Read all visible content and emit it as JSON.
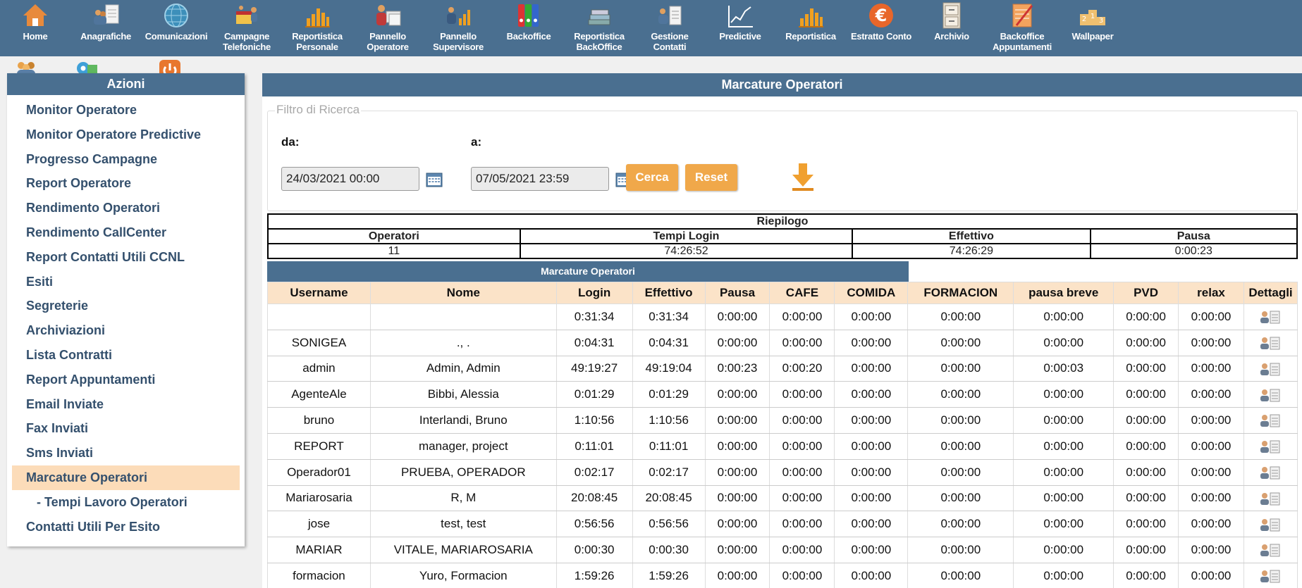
{
  "toolbar": [
    {
      "label": "Home",
      "icon": "home-icon"
    },
    {
      "label": "Anagrafiche",
      "icon": "people-document-icon"
    },
    {
      "label": "Comunicazioni",
      "icon": "globe-network-icon"
    },
    {
      "label": "Campagne\nTelefoniche",
      "icon": "campaign-people-icon"
    },
    {
      "label": "Reportistica\nPersonale",
      "icon": "bar-chart-icon"
    },
    {
      "label": "Pannello\nOperatore",
      "icon": "operator-windows-icon"
    },
    {
      "label": "Pannello\nSupervisore",
      "icon": "supervisor-chart-icon"
    },
    {
      "label": "Backoffice",
      "icon": "binders-icon"
    },
    {
      "label": "Reportistica\nBackOffice",
      "icon": "book-stack-icon"
    },
    {
      "label": "Gestione\nContatti",
      "icon": "contacts-icon"
    },
    {
      "label": "Predictive",
      "icon": "trend-chart-icon"
    },
    {
      "label": "Reportistica",
      "icon": "bar-chart-icon"
    },
    {
      "label": "Estratto Conto",
      "icon": "euro-icon"
    },
    {
      "label": "Archivio",
      "icon": "cabinet-icon"
    },
    {
      "label": "Backoffice\nAppuntamenti",
      "icon": "notepad-icon"
    },
    {
      "label": "Wallpaper",
      "icon": "podium-icon"
    }
  ],
  "sidebar": {
    "title": "Azioni",
    "items": [
      {
        "label": "Monitor Operatore",
        "state": "normal"
      },
      {
        "label": "Monitor Operatore Predictive",
        "state": "normal"
      },
      {
        "label": "Progresso Campagne",
        "state": "normal"
      },
      {
        "label": "Report Operatore",
        "state": "normal"
      },
      {
        "label": "Rendimento Operatori",
        "state": "normal"
      },
      {
        "label": "Rendimento CallCenter",
        "state": "normal"
      },
      {
        "label": "Report Contatti Utili CCNL",
        "state": "normal"
      },
      {
        "label": "Esiti",
        "state": "normal"
      },
      {
        "label": "Segreterie",
        "state": "normal"
      },
      {
        "label": "Archiviazioni",
        "state": "normal"
      },
      {
        "label": "Lista Contratti",
        "state": "normal"
      },
      {
        "label": "Report Appuntamenti",
        "state": "normal"
      },
      {
        "label": "Email Inviate",
        "state": "normal"
      },
      {
        "label": "Fax Inviati",
        "state": "normal"
      },
      {
        "label": "Sms Inviati",
        "state": "normal"
      },
      {
        "label": "Marcature Operatori",
        "state": "active"
      },
      {
        "label": "- Tempi Lavoro Operatori",
        "state": "sub"
      },
      {
        "label": "Contatti Utili Per Esito",
        "state": "normal"
      }
    ]
  },
  "main": {
    "title": "Marcature Operatori",
    "filter": {
      "legend": "Filtro di Ricerca",
      "from_label": "da:",
      "from_value": "24/03/2021 00:00",
      "to_label": "a:",
      "to_value": "07/05/2021 23:59",
      "search_label": "Cerca",
      "reset_label": "Reset"
    },
    "summary": {
      "title": "Riepilogo",
      "headers": [
        "Operatori",
        "Tempi Login",
        "Effettivo",
        "Pausa"
      ],
      "values": [
        "11",
        "74:26:52",
        "74:26:29",
        "0:00:23"
      ]
    },
    "detail": {
      "title": "Marcature Operatori",
      "columns": [
        "Username",
        "Nome",
        "Login",
        "Effettivo",
        "Pausa",
        "CAFE",
        "COMIDA",
        "FORMACION",
        "pausa breve",
        "PVD",
        "relax",
        "Dettagli"
      ],
      "rows": [
        [
          "",
          "",
          "0:31:34",
          "0:31:34",
          "0:00:00",
          "0:00:00",
          "0:00:00",
          "0:00:00",
          "0:00:00",
          "0:00:00",
          "0:00:00"
        ],
        [
          "SONIGEA",
          "., .",
          "0:04:31",
          "0:04:31",
          "0:00:00",
          "0:00:00",
          "0:00:00",
          "0:00:00",
          "0:00:00",
          "0:00:00",
          "0:00:00"
        ],
        [
          "admin",
          "Admin, Admin",
          "49:19:27",
          "49:19:04",
          "0:00:23",
          "0:00:20",
          "0:00:00",
          "0:00:00",
          "0:00:03",
          "0:00:00",
          "0:00:00"
        ],
        [
          "AgenteAle",
          "Bibbi, Alessia",
          "0:01:29",
          "0:01:29",
          "0:00:00",
          "0:00:00",
          "0:00:00",
          "0:00:00",
          "0:00:00",
          "0:00:00",
          "0:00:00"
        ],
        [
          "bruno",
          "Interlandi, Bruno",
          "1:10:56",
          "1:10:56",
          "0:00:00",
          "0:00:00",
          "0:00:00",
          "0:00:00",
          "0:00:00",
          "0:00:00",
          "0:00:00"
        ],
        [
          "REPORT",
          "manager, project",
          "0:11:01",
          "0:11:01",
          "0:00:00",
          "0:00:00",
          "0:00:00",
          "0:00:00",
          "0:00:00",
          "0:00:00",
          "0:00:00"
        ],
        [
          "Operador01",
          "PRUEBA, OPERADOR",
          "0:02:17",
          "0:02:17",
          "0:00:00",
          "0:00:00",
          "0:00:00",
          "0:00:00",
          "0:00:00",
          "0:00:00",
          "0:00:00"
        ],
        [
          "Mariarosaria",
          "R, M",
          "20:08:45",
          "20:08:45",
          "0:00:00",
          "0:00:00",
          "0:00:00",
          "0:00:00",
          "0:00:00",
          "0:00:00",
          "0:00:00"
        ],
        [
          "jose",
          "test, test",
          "0:56:56",
          "0:56:56",
          "0:00:00",
          "0:00:00",
          "0:00:00",
          "0:00:00",
          "0:00:00",
          "0:00:00",
          "0:00:00"
        ],
        [
          "MARIAR",
          "VITALE, MARIAROSARIA",
          "0:00:30",
          "0:00:30",
          "0:00:00",
          "0:00:00",
          "0:00:00",
          "0:00:00",
          "0:00:00",
          "0:00:00",
          "0:00:00"
        ],
        [
          "formacion",
          "Yuro, Formacion",
          "1:59:26",
          "1:59:26",
          "0:00:00",
          "0:00:00",
          "0:00:00",
          "0:00:00",
          "0:00:00",
          "0:00:00",
          "0:00:00"
        ]
      ]
    }
  },
  "colors": {
    "header_blue": "#4a6f90",
    "accent_orange": "#f0a84a",
    "active_item": "#fcdcb9",
    "table_header": "#fbe3c8"
  }
}
